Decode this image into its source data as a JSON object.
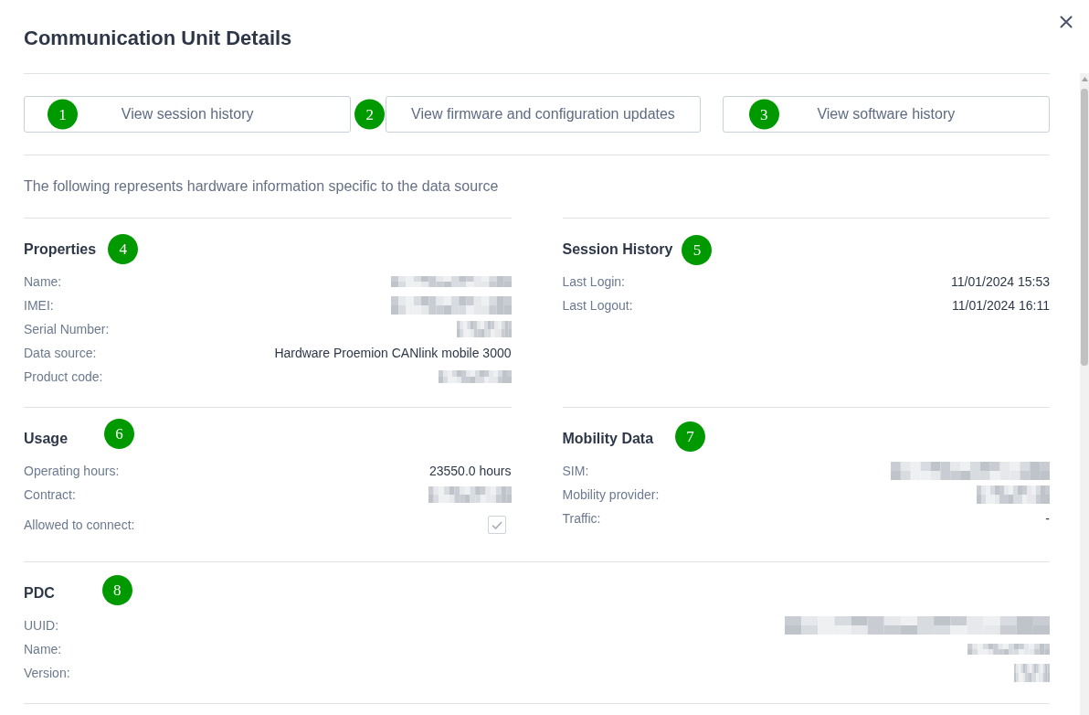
{
  "dialog": {
    "title": "Communication Unit Details"
  },
  "actions": [
    {
      "label": "View session history",
      "marker": "1"
    },
    {
      "label": "View firmware and configuration updates",
      "marker": "2"
    },
    {
      "label": "View software history",
      "marker": "3"
    }
  ],
  "description": "The following represents hardware information specific to the data source",
  "section_rows": [
    [
      {
        "title": "Properties",
        "marker": "4",
        "rows": [
          {
            "label": "Name:",
            "kind": "redacted"
          },
          {
            "label": "IMEI:",
            "kind": "redacted"
          },
          {
            "label": "Serial Number:",
            "kind": "redacted"
          },
          {
            "label": "Data source:",
            "kind": "text",
            "value": "Hardware Proemion CANlink mobile 3000"
          },
          {
            "label": "Product code:",
            "kind": "redacted"
          }
        ]
      },
      {
        "title": "Session History",
        "marker": "5",
        "rows": [
          {
            "label": "Last Login:",
            "kind": "text",
            "value": "11/01/2024 15:53"
          },
          {
            "label": "Last Logout:",
            "kind": "text",
            "value": "11/01/2024 16:11"
          }
        ]
      }
    ],
    [
      {
        "title": "Usage",
        "marker": "6",
        "rows": [
          {
            "label": "Operating hours:",
            "kind": "text",
            "value": "23550.0 hours"
          },
          {
            "label": "Contract:",
            "kind": "redacted"
          },
          {
            "label": "Allowed to connect:",
            "kind": "checkbox",
            "checked": true,
            "disabled": true
          }
        ]
      },
      {
        "title": "Mobility Data",
        "marker": "7",
        "rows": [
          {
            "label": "SIM:",
            "kind": "redacted"
          },
          {
            "label": "Mobility provider:",
            "kind": "redacted"
          },
          {
            "label": "Traffic:",
            "kind": "text",
            "value": "-"
          }
        ]
      }
    ],
    [
      {
        "title": "PDC",
        "marker": "8",
        "rows": [
          {
            "label": "UUID:",
            "kind": "redacted"
          },
          {
            "label": "Name:",
            "kind": "redacted"
          },
          {
            "label": "Version:",
            "kind": "redacted"
          }
        ]
      }
    ]
  ]
}
